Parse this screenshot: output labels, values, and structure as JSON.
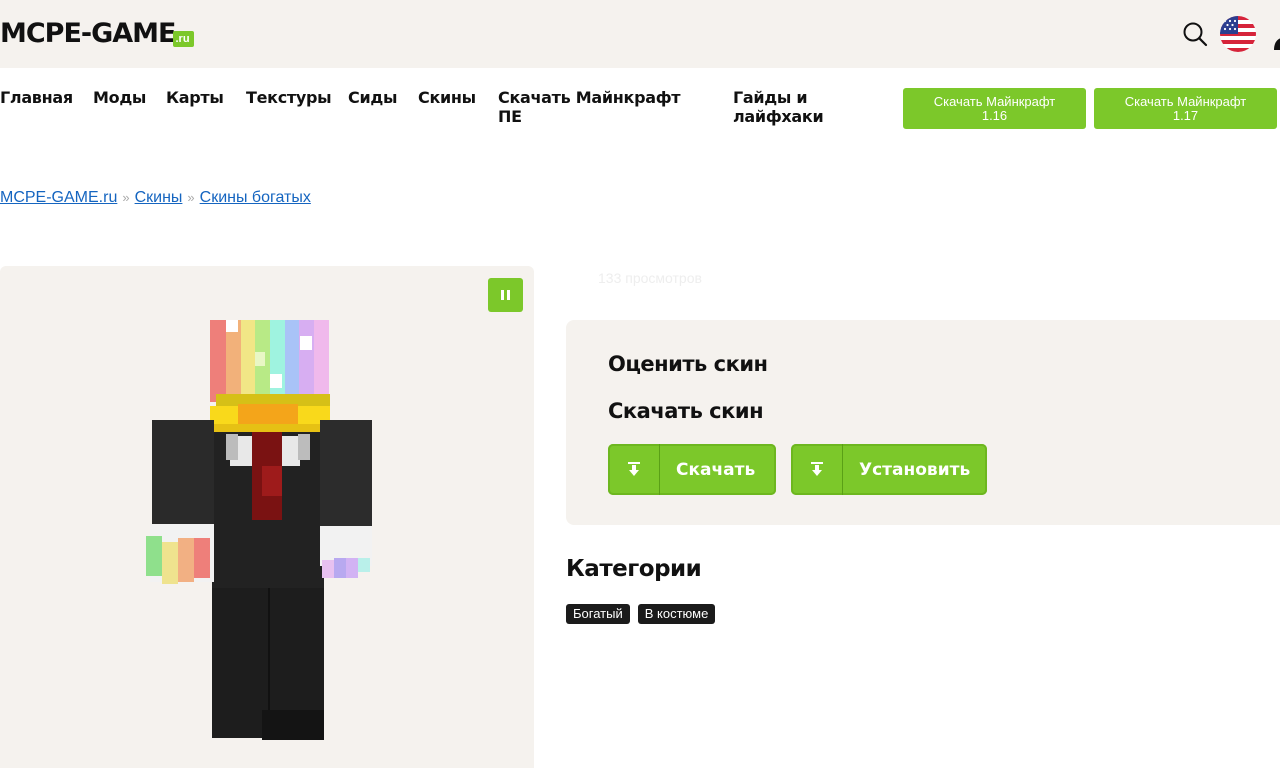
{
  "header": {
    "logo_main": "MCPE-GAME",
    "logo_suffix": ".ru",
    "icons": [
      "search-icon",
      "us-flag-icon",
      "user-icon"
    ]
  },
  "nav": {
    "items": [
      {
        "label": "Главная"
      },
      {
        "label": "Моды"
      },
      {
        "label": "Карты"
      },
      {
        "label": "Текстуры"
      },
      {
        "label": "Сиды"
      },
      {
        "label": "Скины"
      },
      {
        "label": "Скачать Майнкрафт ПЕ"
      },
      {
        "label": "Гайды и лайфхаки"
      }
    ],
    "buttons": [
      {
        "line1": "Скачать Майнкрафт",
        "line2": "1.16"
      },
      {
        "line1": "Скачать Майнкрафт",
        "line2": "1.17"
      }
    ]
  },
  "breadcrumb": {
    "items": [
      "MCPE-GAME.ru",
      "Скины",
      "Скины богатых"
    ],
    "separator": "»"
  },
  "preview": {
    "pause_icon": "pause-icon"
  },
  "views": "133 просмотров",
  "panel": {
    "rate_title": "Оценить скин",
    "download_title": "Скачать скин",
    "download_button": "Скачать",
    "install_button": "Установить"
  },
  "categories": {
    "title": "Категории",
    "tags": [
      "Богатый",
      "В костюме"
    ]
  },
  "colors": {
    "accent": "#7cc82a",
    "topbar_bg": "#f5f2ee",
    "link": "#1565c0"
  }
}
